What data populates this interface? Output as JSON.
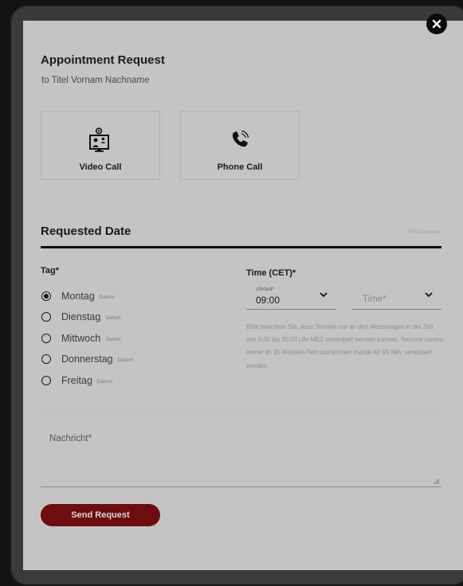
{
  "modal": {
    "title": "Appointment Request",
    "subtitle": "to Titel Vornam Nachname",
    "close_icon": "close-icon"
  },
  "call_types": [
    {
      "label": "Video Call",
      "icon": "video-call-icon"
    },
    {
      "label": "Phone Call",
      "icon": "phone-call-icon"
    }
  ],
  "requested_date": {
    "title": "Requested Date",
    "required_note": "*Pflichtangaben"
  },
  "day": {
    "label": "Tag*",
    "options": [
      {
        "label": "Montag",
        "sub": "Datum",
        "selected": true
      },
      {
        "label": "Dienstag",
        "sub": "Datum",
        "selected": false
      },
      {
        "label": "Mittwoch",
        "sub": "Datum",
        "selected": false
      },
      {
        "label": "Donnerstag",
        "sub": "Datum",
        "selected": false
      },
      {
        "label": "Freitag",
        "sub": "Datum",
        "selected": false
      }
    ]
  },
  "time": {
    "label": "Time (CET)*",
    "from_label": "Uhrzeit*",
    "from_value": "09:00",
    "to_placeholder": "Time*",
    "info": "Bitte beachten Sie, dass Termine nur an den Messetagen in der Zeit von 6:00 bis 20:00 Uhr MEZ vereinbart werden können. Termine starten immer im 15 Minuten-Takt und können maxial für 90 Min. vereinbart werden."
  },
  "message": {
    "placeholder": "Nachricht*"
  },
  "submit": {
    "label": "Send Request"
  },
  "colors": {
    "overlay": "#121212",
    "modal_bg": "#c4c4c4",
    "accent": "#6e0d0f",
    "text": "#1b1b1b"
  }
}
